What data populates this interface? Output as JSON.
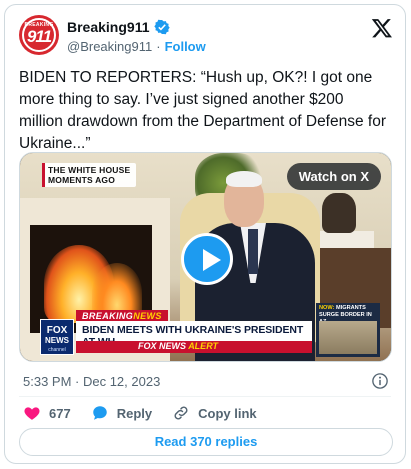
{
  "author": {
    "avatar_small": "BREAKING",
    "avatar_big": "911",
    "display_name": "Breaking911",
    "handle": "@Breaking911",
    "separator": "·",
    "follow_label": "Follow"
  },
  "tweet": {
    "text": "BIDEN TO REPORTERS: “Hush up, OK?! I got one more thing to say. I’ve just signed another $200 million drawdown from the Department of Defense for Ukraine...”"
  },
  "media": {
    "corner_label_line1": "THE WHITE HOUSE",
    "corner_label_line2": "MOMENTS AGO",
    "watch_label": "Watch on X",
    "fox_logo_line1": "FOX",
    "fox_logo_line2": "NEWS",
    "fox_logo_line3": "channel",
    "breaking_word": "BREAKING",
    "news_word": "NEWS",
    "headline": "BIDEN MEETS WITH UKRAINE'S PRESIDENT AT WH",
    "alert_prefix": "FOX NEWS",
    "alert_word": "ALERT",
    "side_now": "NOW:",
    "side_text": "MIGRANTS SURGE BORDER IN AZ"
  },
  "meta": {
    "timestamp": "5:33 PM · Dec 12, 2023"
  },
  "actions": {
    "likes_count": "677",
    "reply_label": "Reply",
    "copy_link_label": "Copy link"
  },
  "replies_button": "Read 370 replies",
  "colors": {
    "accent": "#1d9bf0",
    "like": "#f91880",
    "fox_red": "#c8102e"
  }
}
